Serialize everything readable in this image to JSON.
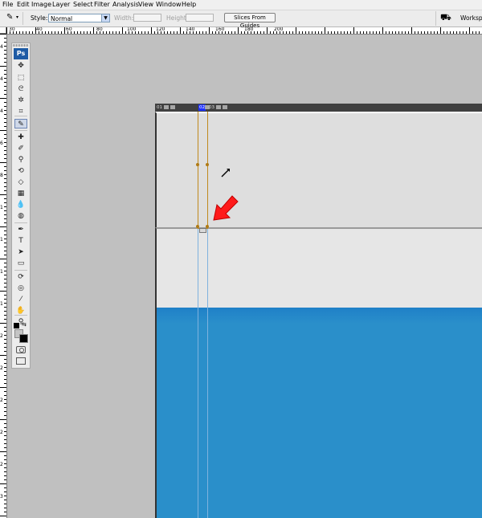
{
  "menu": [
    "File",
    "Edit",
    "Image",
    "Layer",
    "Select",
    "Filter",
    "Analysis",
    "View",
    "Window",
    "Help"
  ],
  "options": {
    "style_label": "Style:",
    "style_value": "Normal",
    "width_label": "Width:",
    "height_label": "Height:",
    "slices_button": "Slices From Guides",
    "workspace_label": "Workspa"
  },
  "ruler_top_labels": [
    "30",
    "40",
    "60",
    "80",
    "100",
    "120",
    "140",
    "160",
    "180",
    "200"
  ],
  "ruler_left_labels": [
    "4",
    "4",
    "4",
    "6",
    "8",
    "1",
    "1",
    "1",
    "1",
    "2",
    "2",
    "2",
    "2",
    "2",
    "3"
  ],
  "toolbox": {
    "logo": "Ps",
    "tools": [
      {
        "name": "move-tool-icon",
        "glyph": "✥"
      },
      {
        "name": "marquee-tool-icon",
        "glyph": "⬚"
      },
      {
        "name": "lasso-tool-icon",
        "glyph": "ᘓ"
      },
      {
        "name": "magic-wand-tool-icon",
        "glyph": "✲"
      },
      {
        "name": "crop-tool-icon",
        "glyph": "⌗"
      },
      {
        "name": "slice-select-tool-icon",
        "glyph": "✎"
      },
      {
        "name": "healing-brush-tool-icon",
        "glyph": "✚"
      },
      {
        "name": "brush-tool-icon",
        "glyph": "✐"
      },
      {
        "name": "clone-stamp-tool-icon",
        "glyph": "⚲"
      },
      {
        "name": "history-brush-tool-icon",
        "glyph": "⟲"
      },
      {
        "name": "eraser-tool-icon",
        "glyph": "◇"
      },
      {
        "name": "gradient-tool-icon",
        "glyph": "▦"
      },
      {
        "name": "blur-tool-icon",
        "glyph": "💧"
      },
      {
        "name": "dodge-tool-icon",
        "glyph": "◍"
      },
      {
        "name": "pen-tool-icon",
        "glyph": "✒"
      },
      {
        "name": "type-tool-icon",
        "glyph": "T"
      },
      {
        "name": "path-selection-tool-icon",
        "glyph": "➤"
      },
      {
        "name": "rectangle-tool-icon",
        "glyph": "▭"
      },
      {
        "name": "3d-rotate-tool-icon",
        "glyph": "⟳"
      },
      {
        "name": "3d-orbit-tool-icon",
        "glyph": "◎"
      },
      {
        "name": "eyedropper-tool-icon",
        "glyph": "⁄"
      },
      {
        "name": "hand-tool-icon",
        "glyph": "✋"
      },
      {
        "name": "zoom-tool-icon",
        "glyph": "⚲"
      }
    ]
  },
  "document": {
    "slice_tabs": [
      "01",
      "02",
      "03"
    ],
    "active_slice": "02"
  },
  "colors": {
    "canvas_blue": "#2a8fca",
    "slice_border": "#c08a1e",
    "guide": "#7fb2de",
    "active_tab": "#1d2fff",
    "arrow": "#ff1a1a"
  }
}
